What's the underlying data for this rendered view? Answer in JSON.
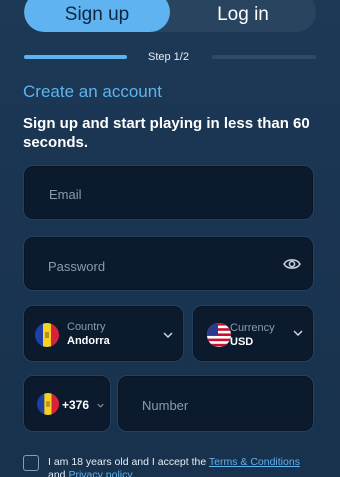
{
  "tabs": {
    "signup": "Sign up",
    "login": "Log in"
  },
  "steps": {
    "label": "Step 1/2",
    "progress": 0.5
  },
  "form": {
    "title": "Create an account",
    "subtitle": "Sign up and start playing in less than 60 seconds.",
    "email_placeholder": "Email",
    "password_placeholder": "Password",
    "country": {
      "label": "Country",
      "value": "Andorra"
    },
    "currency": {
      "label": "Currency",
      "value": "USD"
    },
    "phone_code": "+376",
    "number_placeholder": "Number",
    "terms": {
      "prefix": "I am 18 years old and I accept the ",
      "terms_link": "Terms & Conditions",
      "middle": " and ",
      "privacy_link": "Privacy policy"
    }
  },
  "colors": {
    "accent": "#5fb3f0",
    "background": "#1a3552",
    "field": "#0b1b2d"
  },
  "icons": [
    "eye-icon",
    "chevron-down-icon",
    "andorra-flag-icon",
    "usa-flag-icon",
    "checkbox-icon"
  ]
}
